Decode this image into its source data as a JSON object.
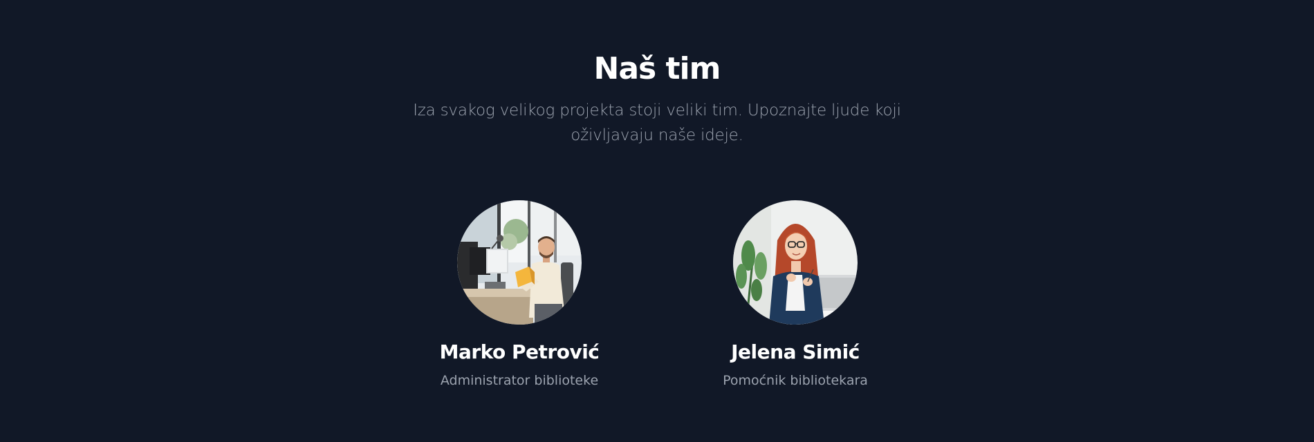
{
  "section": {
    "title": "Naš tim",
    "subtitle": "Iza svakog velikog projekta stoji veliki tim. Upoznajte ljude koji oživljavaju naše ideje."
  },
  "team": [
    {
      "name": "Marko Petrović",
      "role": "Administrator biblioteke",
      "photo": "man-reading-book-at-desk"
    },
    {
      "name": "Jelena Simić",
      "role": "Pomoćnik bibliotekara",
      "photo": "woman-with-glasses-at-laptop"
    }
  ],
  "colors": {
    "background": "#111827",
    "heading": "#ffffff",
    "muted": "#9ca3af"
  }
}
